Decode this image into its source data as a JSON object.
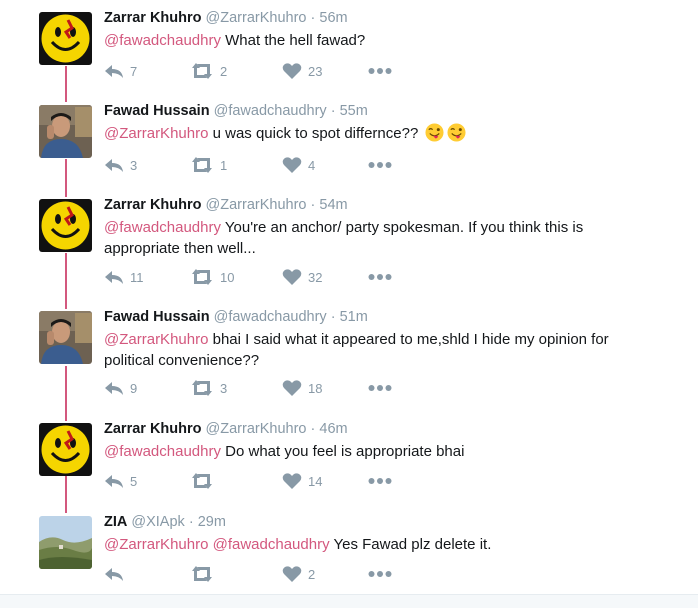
{
  "colors": {
    "mention": "#d3587e",
    "thread_line": "#d3587e",
    "muted": "#8899a6",
    "text": "#14171a"
  },
  "tweets": [
    {
      "name": "Zarrar Khuhro",
      "handle": "@ZarrarKhuhro",
      "time": "56m",
      "avatar": "smiley-avatar",
      "mentions": [
        "@fawadchaudhry"
      ],
      "body": "What the hell fawad?",
      "replies": "7",
      "retweets": "2",
      "likes": "23"
    },
    {
      "name": "Fawad Hussain",
      "handle": "@fawadchaudhry",
      "time": "55m",
      "avatar": "person-photo-avatar",
      "mentions": [
        "@ZarrarKhuhro"
      ],
      "body": "u was quick to spot differnce??",
      "emojis": [
        "winking-tongue-emoji",
        "winking-tongue-emoji"
      ],
      "replies": "3",
      "retweets": "1",
      "likes": "4"
    },
    {
      "name": "Zarrar Khuhro",
      "handle": "@ZarrarKhuhro",
      "time": "54m",
      "avatar": "smiley-avatar",
      "mentions": [
        "@fawadchaudhry"
      ],
      "body": "You're an anchor/ party spokesman. If you think this is appropriate then well...",
      "replies": "11",
      "retweets": "10",
      "likes": "32"
    },
    {
      "name": "Fawad Hussain",
      "handle": "@fawadchaudhry",
      "time": "51m",
      "avatar": "person-photo-avatar",
      "mentions": [
        "@ZarrarKhuhro"
      ],
      "body": "bhai I said what it appeared to me,shld I hide my opinion for political convenience??",
      "replies": "9",
      "retweets": "3",
      "likes": "18"
    },
    {
      "name": "Zarrar Khuhro",
      "handle": "@ZarrarKhuhro",
      "time": "46m",
      "avatar": "smiley-avatar",
      "mentions": [
        "@fawadchaudhry"
      ],
      "body": "Do what you feel is appropriate bhai",
      "replies": "5",
      "retweets": "",
      "likes": "14"
    },
    {
      "name": "ZIA",
      "handle": "@XIApk",
      "time": "29m",
      "avatar": "landscape-photo-avatar",
      "mentions": [
        "@ZarrarKhuhro",
        "@fawadchaudhry"
      ],
      "body": "Yes Fawad plz delete it.",
      "replies": "",
      "retweets": "",
      "likes": "2"
    }
  ]
}
